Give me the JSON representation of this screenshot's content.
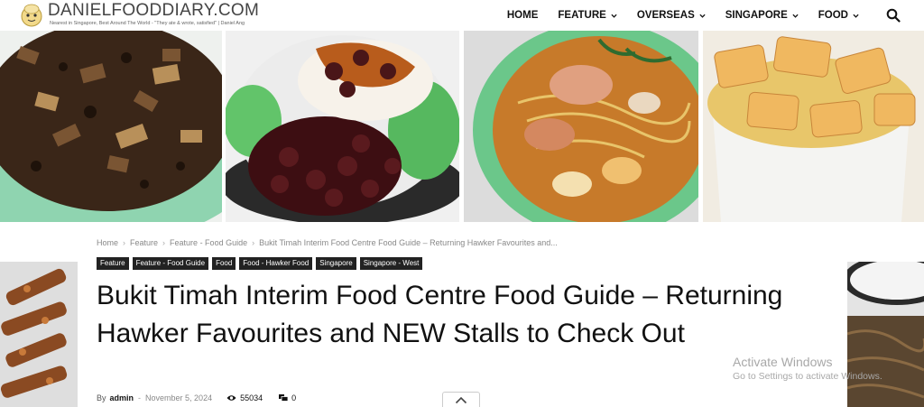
{
  "site": {
    "logo_text": "DANIELFOODDIARY.COM",
    "tagline": "Nearest in Singapore, Best Around The World - \"They ate & wrote, satisfied\" | Daniel Ang"
  },
  "nav": {
    "items": [
      {
        "label": "HOME",
        "dropdown": false
      },
      {
        "label": "FEATURE",
        "dropdown": true
      },
      {
        "label": "OVERSEAS",
        "dropdown": true
      },
      {
        "label": "SINGAPORE",
        "dropdown": true
      },
      {
        "label": "FOOD",
        "dropdown": true
      }
    ],
    "search_icon": "search-icon"
  },
  "article": {
    "breadcrumb": [
      "Home",
      "Feature",
      "Feature - Food Guide",
      "Bukit Timah Interim Food Centre Food Guide – Returning Hawker Favourites and..."
    ],
    "tags": [
      "Feature",
      "Feature - Food Guide",
      "Food",
      "Food - Hawker Food",
      "Singapore",
      "Singapore - West"
    ],
    "title": "Bukit Timah Interim Food Centre Food Guide – Returning Hawker Favourites and NEW Stalls to Check Out",
    "by_label": "By",
    "author": "admin",
    "date": "November 5, 2024",
    "views": "55034",
    "comments": "0"
  },
  "overlay": {
    "activate_title": "Activate Windows",
    "activate_sub": "Go to Settings to activate Windows."
  },
  "colors": {
    "tag_bg": "#222222",
    "accent_text": "#111111"
  }
}
